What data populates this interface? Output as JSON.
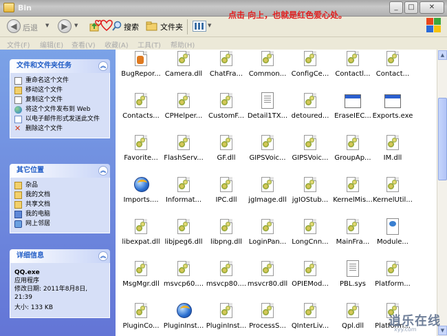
{
  "window": {
    "title": "Bin"
  },
  "toolbar": {
    "back_label": "后退",
    "search_label": "搜索",
    "folders_label": "文件夹"
  },
  "annotation": "点击 向上，也就是红色爱心处。",
  "menubar": {
    "items": [
      "文件(F)",
      "编辑(E)",
      "查看(V)",
      "收藏(A)",
      "工具(T)",
      "帮助(H)"
    ]
  },
  "tasks": {
    "title": "文件和文件夹任务",
    "items": [
      "重命名这个文件",
      "移动这个文件",
      "复制这个文件",
      "将这个文件发布到 Web",
      "以电子邮件形式发送此文件",
      "删除这个文件"
    ]
  },
  "places": {
    "title": "其它位置",
    "items": [
      "杂品",
      "我的文档",
      "共享文档",
      "我的电脑",
      "网上邻居"
    ]
  },
  "details": {
    "title": "详细信息",
    "name": "QQ.exe",
    "type": "应用程序",
    "modified": "修改日期: 2011年8月8日, 21:39",
    "size": "大小: 133 KB"
  },
  "files": [
    [
      "BugRepor...",
      "Camera.dll",
      "ChatFra...",
      "Common...",
      "ConfigCe...",
      "Contactl...",
      "Contact..."
    ],
    [
      "Contacts...",
      "CPHelper...",
      "CustomF...",
      "Detail1TX...",
      "detoured...",
      "EraseIEC...",
      "Exports.exe"
    ],
    [
      "Favorite...",
      "FlashServ...",
      "GF.dll",
      "GIPSVoic...",
      "GIPSVoic...",
      "GroupAp...",
      "IM.dll"
    ],
    [
      "Imports....",
      "Informat...",
      "IPC.dll",
      "jgImage.dll",
      "jgIOStub...",
      "KernelMis...",
      "KernelUtil..."
    ],
    [
      "libexpat.dll",
      "libjpeg6.dll",
      "libpng.dll",
      "LoginPan...",
      "LongCnn...",
      "MainFra...",
      "Module..."
    ],
    [
      "MsgMgr.dll",
      "msvcp60....",
      "msvcp80....",
      "msvcr80.dll",
      "OPIEMod...",
      "PBL.sys",
      "Platform..."
    ],
    [
      "PluginCo...",
      "PluginInst...",
      "PluginInst...",
      "ProcessS...",
      "QInterLiv...",
      "Qpl.dll",
      "Platform..."
    ]
  ],
  "watermark": {
    "text": "逍乐在线",
    "sub": "xyy.com"
  }
}
